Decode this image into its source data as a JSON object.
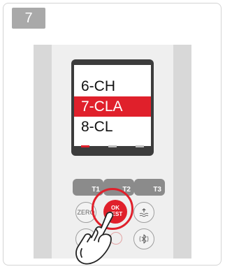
{
  "step": {
    "number": "7"
  },
  "screen": {
    "menu": [
      "6-CH",
      "7-CLA",
      "8-CL"
    ],
    "selected_index": 1
  },
  "softkeys": [
    "T1",
    "T2",
    "T3"
  ],
  "buttons": {
    "zero": "ZERO",
    "ok_line1": "OK",
    "ok_line2": "TEST"
  },
  "colors": {
    "accent": "#e0202b",
    "rail": "#d8d8d8",
    "screen_frame": "#3c3c3c"
  },
  "icons": [
    "water-level-icon",
    "bluetooth-icon",
    "pointing-hand-icon"
  ]
}
